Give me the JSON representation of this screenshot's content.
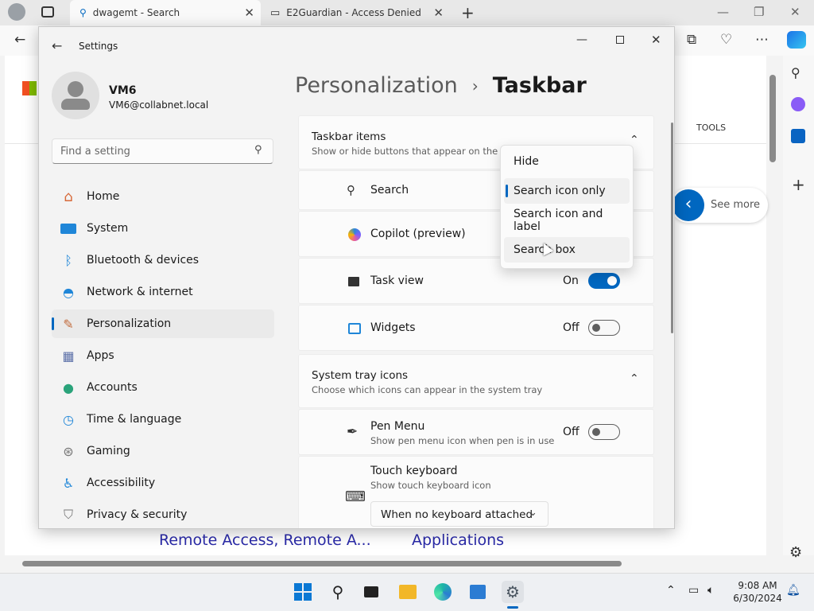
{
  "browser": {
    "tabs": [
      {
        "title": "dwagemt - Search"
      },
      {
        "title": "E2Guardian - Access Denied"
      }
    ]
  },
  "webpage": {
    "tools_label": "TOOLS",
    "see_more": "See more",
    "link1": "Remote Access, Remote A...",
    "link2": "Applications"
  },
  "settings": {
    "app_title": "Settings",
    "user": {
      "name": "VM6",
      "email": "VM6@collabnet.local"
    },
    "search_placeholder": "Find a setting",
    "nav": [
      {
        "label": "Home"
      },
      {
        "label": "System"
      },
      {
        "label": "Bluetooth & devices"
      },
      {
        "label": "Network & internet"
      },
      {
        "label": "Personalization"
      },
      {
        "label": "Apps"
      },
      {
        "label": "Accounts"
      },
      {
        "label": "Time & language"
      },
      {
        "label": "Gaming"
      },
      {
        "label": "Accessibility"
      },
      {
        "label": "Privacy & security"
      }
    ],
    "breadcrumb": {
      "parent": "Personalization",
      "separator": "›",
      "current": "Taskbar"
    },
    "taskbar_items": {
      "title": "Taskbar items",
      "subtitle": "Show or hide buttons that appear on the tas",
      "search_label": "Search",
      "copilot_label": "Copilot (preview)",
      "taskview_label": "Task view",
      "taskview_state": "On",
      "widgets_label": "Widgets",
      "widgets_state": "Off"
    },
    "search_dropdown": {
      "options": [
        "Hide",
        "Search icon only",
        "Search icon and label",
        "Search box"
      ],
      "selected": "Search icon only"
    },
    "system_tray": {
      "title": "System tray icons",
      "subtitle": "Choose which icons can appear in the system tray",
      "pen_label": "Pen Menu",
      "pen_sub": "Show pen menu icon when pen is in use",
      "pen_state": "Off",
      "keyboard_label": "Touch keyboard",
      "keyboard_sub": "Show touch keyboard icon",
      "keyboard_select": "When no keyboard attached"
    }
  },
  "clock": {
    "time": "9:08 AM",
    "date": "6/30/2024"
  },
  "colors": {
    "accent": "#0067c0"
  }
}
